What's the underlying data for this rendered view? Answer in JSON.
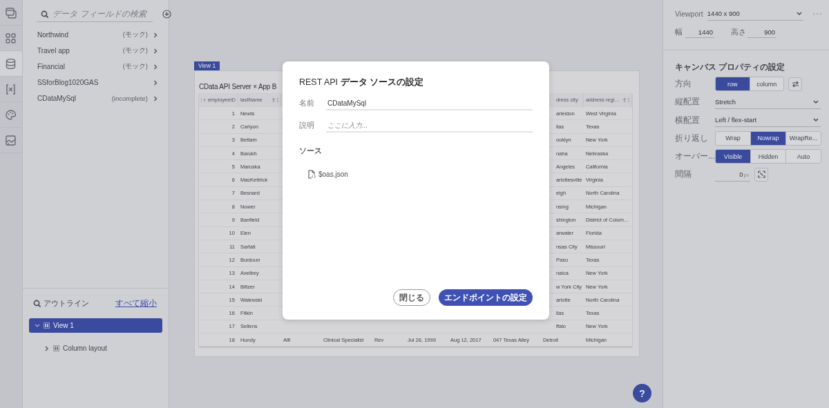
{
  "icon_rail": {
    "items": [
      {
        "kind": "windows",
        "selected": false
      },
      {
        "kind": "grid",
        "selected": false
      },
      {
        "kind": "database",
        "selected": true
      },
      {
        "kind": "variable",
        "selected": false
      },
      {
        "kind": "palette",
        "selected": false
      },
      {
        "kind": "image",
        "selected": false
      }
    ]
  },
  "data_panel": {
    "search": {
      "placeholder": "データ フィールドの検索"
    },
    "sources": [
      {
        "name": "Northwind",
        "note": "(モック)"
      },
      {
        "name": "Travel app",
        "note": "(モック)"
      },
      {
        "name": "Financial",
        "note": "(モック)"
      },
      {
        "name": "SSforBlog1020GAS"
      },
      {
        "name": "CDataMySql",
        "note": "(incomplete)"
      }
    ]
  },
  "outline": {
    "title": "アウトライン",
    "collapse_link": "すべて縮小",
    "tree": [
      {
        "label": "View 1",
        "selected": true,
        "expanded": true,
        "children": [
          {
            "label": "Column layout",
            "selected": false,
            "expanded": false
          }
        ]
      }
    ]
  },
  "canvas": {
    "view_tab": "View 1",
    "title": "CData API Server × App B",
    "table": {
      "columns": [
        {
          "label": "employeeID",
          "covered": false
        },
        {
          "label": "lastName",
          "covered": false
        },
        {
          "label": "dress city",
          "covered": true
        },
        {
          "label": "address regi…",
          "covered": false
        }
      ],
      "rows": [
        {
          "covered": true,
          "cells": [
            "1",
            "Newis",
            "arleston",
            "West Virginia"
          ]
        },
        {
          "covered": true,
          "cells": [
            "2",
            "Carlyon",
            "llas",
            "Texas"
          ]
        },
        {
          "covered": true,
          "cells": [
            "3",
            "Bettam",
            "ooklyn",
            "New York"
          ]
        },
        {
          "covered": true,
          "cells": [
            "4",
            "Barukh",
            "naha",
            "Nebraska"
          ]
        },
        {
          "covered": true,
          "cells": [
            "5",
            "Maruska",
            "Angeles",
            "California"
          ]
        },
        {
          "covered": true,
          "cells": [
            "6",
            "MacKettrick",
            "arlottesville",
            "Virginia"
          ]
        },
        {
          "covered": true,
          "cells": [
            "7",
            "Besnard",
            "eigh",
            "North Carolina"
          ]
        },
        {
          "covered": true,
          "cells": [
            "8",
            "Nower",
            "nsing",
            "Michigan"
          ]
        },
        {
          "covered": true,
          "cells": [
            "9",
            "Banfield",
            "shington",
            "District of Colum…"
          ]
        },
        {
          "covered": true,
          "cells": [
            "10",
            "Elen",
            "arwater",
            "Florida"
          ]
        },
        {
          "covered": true,
          "cells": [
            "11",
            "Sarfati",
            "nsas City",
            "Missouri"
          ]
        },
        {
          "covered": true,
          "cells": [
            "12",
            "Burdoun",
            "Paso",
            "Texas"
          ]
        },
        {
          "covered": true,
          "cells": [
            "13",
            "Axelbey",
            "naica",
            "New York"
          ]
        },
        {
          "covered": true,
          "cells": [
            "14",
            "Blitzer",
            "w York City",
            "New York"
          ]
        },
        {
          "covered": true,
          "cells": [
            "15",
            "Walewski",
            "arlotte",
            "North Carolina"
          ]
        },
        {
          "covered": true,
          "cells": [
            "16",
            "Fitkin",
            "llas",
            "Texas"
          ]
        },
        {
          "covered": true,
          "cells": [
            "17",
            "Sellens",
            "ffalo",
            "New York"
          ]
        },
        {
          "covered": false,
          "cells": [
            "18",
            "Hundy",
            "Alfi",
            "Clinical Specialist",
            "Rev",
            "Jul 26, 1999",
            "Aug 12, 2017",
            "047 Texas Alley",
            "Detroit",
            "Michigan"
          ]
        }
      ]
    }
  },
  "dialog": {
    "title": "REST API **データ ソースの設定**",
    "fields": [
      {
        "label": "名前",
        "value": "CDataMySql"
      },
      {
        "label": "説明",
        "placeholder": "ここに入力..."
      }
    ],
    "source_heading": "ソース",
    "source_file": "$oas.json",
    "buttons": [
      {
        "label": "閉じる",
        "kind": "secondary"
      },
      {
        "label": "エンドポイントの設定",
        "kind": "primary"
      }
    ]
  },
  "properties": {
    "viewport": {
      "label": "Viewport",
      "value": "1440 x 900"
    },
    "size": [
      {
        "label": "幅",
        "value": "1440"
      },
      {
        "label": "高さ",
        "value": "900"
      }
    ],
    "section_title": "キャンバス プロパティの設定",
    "rows": [
      {
        "kind": "segmented",
        "label": "方向",
        "swap": true,
        "options": [
          {
            "label": "row",
            "selected": true
          },
          {
            "label": "column",
            "selected": false
          }
        ]
      },
      {
        "kind": "select",
        "label": "縦配置",
        "value": "Stretch"
      },
      {
        "kind": "select",
        "label": "横配置",
        "value": "Left / flex-start"
      },
      {
        "kind": "segmented",
        "label": "折り返し",
        "options": [
          {
            "label": "Wrap",
            "selected": false
          },
          {
            "label": "Nowrap",
            "selected": true
          },
          {
            "label": "WrapRe...",
            "selected": false
          }
        ]
      },
      {
        "kind": "segmented",
        "label": "オーバー...",
        "options": [
          {
            "label": "Visible",
            "selected": true
          },
          {
            "label": "Hidden",
            "selected": false
          },
          {
            "label": "Auto",
            "selected": false
          }
        ]
      },
      {
        "kind": "number",
        "label": "間隔",
        "value": "0",
        "unit": "px"
      }
    ]
  },
  "help_button": "?"
}
